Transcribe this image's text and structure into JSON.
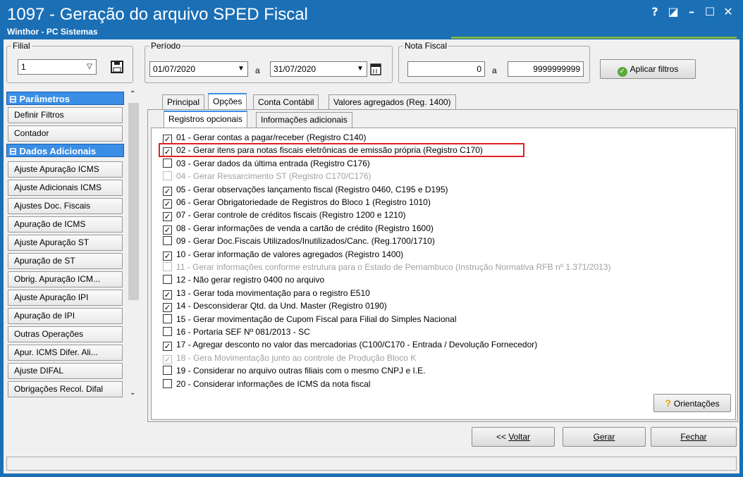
{
  "window": {
    "title": "1097 - Geração do arquivo SPED Fiscal",
    "subtitle": "Winthor - PC Sistemas",
    "controls": [
      "?",
      "◪",
      "–",
      "☐",
      "✕"
    ]
  },
  "filters": {
    "filial_label": "Filial",
    "filial_value": "1",
    "periodo_label": "Período",
    "date_from": "01/07/2020",
    "date_sep": "a",
    "date_to": "31/07/2020",
    "nota_label": "Nota Fiscal",
    "nota_from": "0",
    "nota_sep": "a",
    "nota_to": "9999999999",
    "apply_label": "Aplicar filtros"
  },
  "sidebar": {
    "sections": [
      {
        "header": "Parâmetros",
        "items": [
          "Definir Filtros",
          "Contador"
        ]
      },
      {
        "header": "Dados Adicionais",
        "items": [
          "Ajuste Apuração ICMS",
          "Ajuste Adicionais ICMS",
          "Ajustes Doc. Fiscais",
          "Apuração de ICMS",
          "Ajuste Apuração ST",
          "Apuração de ST",
          "Obrig. Apuração ICM...",
          "Ajuste Apuração IPI",
          "Apuração de IPI",
          "Outras Operações",
          "Apur. ICMS Difer. Ali...",
          "Ajuste DIFAL",
          "Obrigações Recol. Difal"
        ]
      }
    ]
  },
  "tabs": [
    "Principal",
    "Opções",
    "Conta Contábil",
    "Valores agregados (Reg. 1400)"
  ],
  "subtabs": [
    "Registros opcionais",
    "Informações adicionais"
  ],
  "options": [
    {
      "label": "01 - Gerar contas a pagar/receber (Registro C140)",
      "checked": true,
      "disabled": false
    },
    {
      "label": "02 - Gerar itens para notas fiscais eletrônicas de emissão própria (Registro C170)",
      "checked": true,
      "disabled": false
    },
    {
      "label": "03 - Gerar dados da última entrada (Registro C176)",
      "checked": false,
      "disabled": false
    },
    {
      "label": "04 - Gerar Ressarcimento ST (Registro C170/C176)",
      "checked": false,
      "disabled": true
    },
    {
      "label": "05 - Gerar observações lançamento fiscal (Registro 0460, C195 e D195)",
      "checked": true,
      "disabled": false
    },
    {
      "label": "06 - Gerar Obrigatoriedade de Registros do Bloco 1 (Registro  1010)",
      "checked": true,
      "disabled": false
    },
    {
      "label": "07 - Gerar controle de créditos fiscais (Registro 1200 e 1210)",
      "checked": true,
      "disabled": false
    },
    {
      "label": "08 - Gerar informações de venda a cartão de crédito (Registro 1600)",
      "checked": true,
      "disabled": false
    },
    {
      "label": "09 - Gerar Doc.Fiscais Utilizados/Inutilizados/Canc. (Reg.1700/1710)",
      "checked": false,
      "disabled": false
    },
    {
      "label": "10 - Gerar informação de valores agregados (Registro 1400)",
      "checked": true,
      "disabled": false
    },
    {
      "label": "11 - Gerar informações conforme estrutura para o Estado de Pernambuco (Instrução Normativa RFB nº 1.371/2013)",
      "checked": false,
      "disabled": true
    },
    {
      "label": "12 - Não gerar registro 0400 no arquivo",
      "checked": false,
      "disabled": false
    },
    {
      "label": "13 - Gerar toda movimentação para o registro E510",
      "checked": true,
      "disabled": false
    },
    {
      "label": "14 - Desconsiderar Qtd. da Und. Master (Registro 0190)",
      "checked": true,
      "disabled": false
    },
    {
      "label": "15 - Gerar movimentação de Cupom Fiscal para Filial do Simples Nacional",
      "checked": false,
      "disabled": false
    },
    {
      "label": "16 - Portaria SEF Nº 081/2013 - SC",
      "checked": false,
      "disabled": false
    },
    {
      "label": "17 - Agregar desconto no valor das mercadorias (C100/C170 - Entrada / Devolução Fornecedor)",
      "checked": true,
      "disabled": false
    },
    {
      "label": "18 - Gera Movimentação junto ao controle de Produção Bloco K",
      "checked": true,
      "disabled": true
    },
    {
      "label": "19 - Considerar no arquivo outras filiais com o mesmo CNPJ e I.E.",
      "checked": false,
      "disabled": false
    },
    {
      "label": "20 - Considerar informações de ICMS da nota fiscal",
      "checked": false,
      "disabled": false
    }
  ],
  "orientacoes_label": "Orientações",
  "footer": {
    "back_prefix": "<< ",
    "back_label": "Voltar",
    "generate_label": "Gerar",
    "close_label": "Fechar"
  },
  "icons": {
    "save": "floppy-disk-icon",
    "calendar": "calendar-icon",
    "apply": "check-circle-icon",
    "help": "question-icon"
  },
  "colors": {
    "titlebar": "#1b6fb5",
    "section_header": "#3a8ee6",
    "highlight": "#e02020"
  }
}
